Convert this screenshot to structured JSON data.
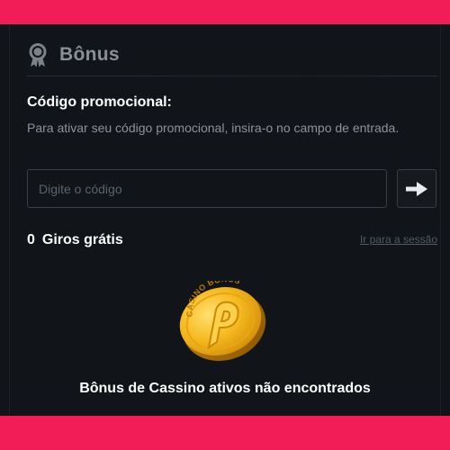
{
  "header": {
    "title": "Bônus",
    "icon": "award-ribbon-icon"
  },
  "promo": {
    "title": "Código promocional:",
    "description": "Para ativar seu código promocional, insira-o no campo de entrada.",
    "input_value": "",
    "input_placeholder": "Digite o código",
    "submit_icon": "arrow-right-icon"
  },
  "free_spins": {
    "count": "0",
    "label": "Giros grátis",
    "link_label": "Ir para a sessão"
  },
  "empty_state": {
    "coin_text": "CASINO BONUS",
    "message": "Bônus de Cassino ativos não encontrados"
  },
  "colors": {
    "brand_bar": "#f21d56",
    "panel_bg": "#111418",
    "coin_gold": "#f2b21a"
  }
}
